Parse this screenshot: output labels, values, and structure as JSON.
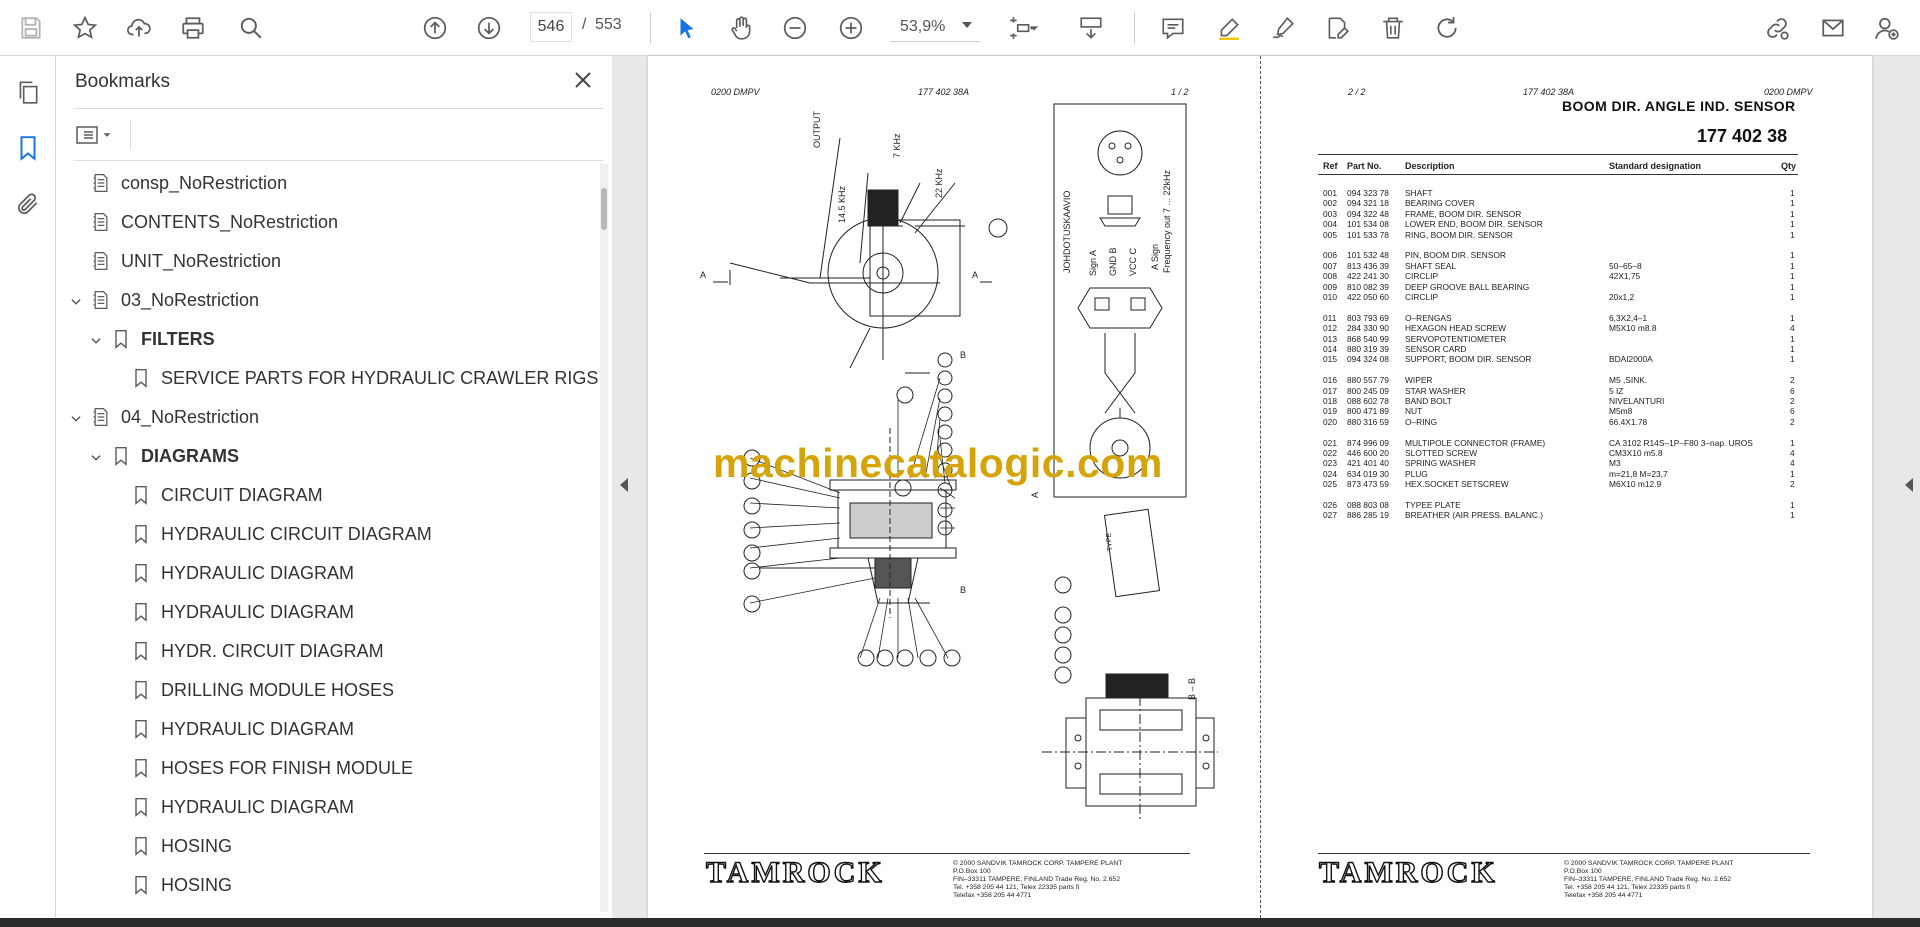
{
  "toolbar": {
    "page_current": "546",
    "page_separator": "/",
    "page_total": "553",
    "zoom_value": "53,9%"
  },
  "bookmarks_panel": {
    "title": "Bookmarks",
    "items": [
      {
        "label": "consp_NoRestriction",
        "level": 0,
        "type": "root",
        "expanded": null
      },
      {
        "label": "CONTENTS_NoRestriction",
        "level": 0,
        "type": "root",
        "expanded": null
      },
      {
        "label": "UNIT_NoRestriction",
        "level": 0,
        "type": "root",
        "expanded": null
      },
      {
        "label": "03_NoRestriction",
        "level": 0,
        "type": "root",
        "expanded": true
      },
      {
        "label": "FILTERS",
        "level": 1,
        "type": "bookmark",
        "expanded": true,
        "bold": true
      },
      {
        "label": "SERVICE PARTS FOR HYDRAULIC CRAWLER RIGS",
        "level": 2,
        "type": "bookmark",
        "expanded": null
      },
      {
        "label": "04_NoRestriction",
        "level": 0,
        "type": "root",
        "expanded": true
      },
      {
        "label": "DIAGRAMS",
        "level": 1,
        "type": "bookmark",
        "expanded": true,
        "bold": true
      },
      {
        "label": "CIRCUIT DIAGRAM",
        "level": 2,
        "type": "bookmark",
        "expanded": null
      },
      {
        "label": "HYDRAULIC CIRCUIT DIAGRAM",
        "level": 2,
        "type": "bookmark",
        "expanded": null
      },
      {
        "label": "HYDRAULIC DIAGRAM",
        "level": 2,
        "type": "bookmark",
        "expanded": null
      },
      {
        "label": "HYDRAULIC DIAGRAM",
        "level": 2,
        "type": "bookmark",
        "expanded": null
      },
      {
        "label": "HYDR. CIRCUIT DIAGRAM",
        "level": 2,
        "type": "bookmark",
        "expanded": null
      },
      {
        "label": "DRILLING MODULE HOSES",
        "level": 2,
        "type": "bookmark",
        "expanded": null
      },
      {
        "label": "HYDRAULIC DIAGRAM",
        "level": 2,
        "type": "bookmark",
        "expanded": null
      },
      {
        "label": "HOSES FOR FINISH MODULE",
        "level": 2,
        "type": "bookmark",
        "expanded": null
      },
      {
        "label": "HYDRAULIC DIAGRAM",
        "level": 2,
        "type": "bookmark",
        "expanded": null
      },
      {
        "label": "HOSING",
        "level": 2,
        "type": "bookmark",
        "expanded": null
      },
      {
        "label": "HOSING",
        "level": 2,
        "type": "bookmark",
        "expanded": null
      }
    ]
  },
  "left_page": {
    "header_code": "0200 DMPV",
    "header_part": "177 402 38A",
    "header_page": "1 /  2",
    "wiring_label": "JOHDOTUSKAAVIO",
    "sign_a": "Sign A",
    "gnd_b": "GND B",
    "vcc_c": "VCC C",
    "sign_label": "A Sign",
    "freq_label": "Frequency out 7 ... 22kHz",
    "output_label": "OUTPUT",
    "k7": "7 KHz",
    "k22": "22 KHz",
    "k145": "14.5 KHz",
    "section_a": "A",
    "section_b": "B",
    "section_bb": "B – B",
    "plate_text": "TAMROCK"
  },
  "right_page": {
    "header_page": "2 /  2",
    "header_part": "177 402 38A",
    "header_code": "0200 DMPV",
    "title": "BOOM DIR. ANGLE IND. SENSOR",
    "part_number": "177 402 38",
    "columns": {
      "ref": "Ref",
      "part_no": "Part No.",
      "description": "Description",
      "standard": "Standard designation",
      "qty": "Qty"
    },
    "rows": [
      {
        "ref": "001",
        "part": "094 323 78",
        "desc": "SHAFT",
        "std": "",
        "qty": "1"
      },
      {
        "ref": "002",
        "part": "094 321 18",
        "desc": "BEARING COVER",
        "std": "",
        "qty": "1"
      },
      {
        "ref": "003",
        "part": "094 322 48",
        "desc": "FRAME, BOOM DIR. SENSOR",
        "std": "",
        "qty": "1"
      },
      {
        "ref": "004",
        "part": "101 534 08",
        "desc": "LOWER END, BOOM DIR. SENSOR",
        "std": "",
        "qty": "1"
      },
      {
        "ref": "005",
        "part": "101 533 78",
        "desc": "RING, BOOM DIR. SENSOR",
        "std": "",
        "qty": "1"
      },
      {
        "ref": "006",
        "part": "101 532 48",
        "desc": "PIN, BOOM DIR. SENSOR",
        "std": "",
        "qty": "1"
      },
      {
        "ref": "007",
        "part": "813 436 39",
        "desc": "SHAFT SEAL",
        "std": "50–65–8",
        "qty": "1"
      },
      {
        "ref": "008",
        "part": "422 241 30",
        "desc": "CIRCLIP",
        "std": "42X1,75",
        "qty": "1"
      },
      {
        "ref": "009",
        "part": "810 082 39",
        "desc": "DEEP GROOVE BALL BEARING",
        "std": "",
        "qty": "1"
      },
      {
        "ref": "010",
        "part": "422 050 60",
        "desc": "CIRCLIP",
        "std": "20x1,2",
        "qty": "1"
      },
      {
        "ref": "011",
        "part": "803 793 69",
        "desc": "O–RENGAS",
        "std": "6,3X2,4–1",
        "qty": "1"
      },
      {
        "ref": "012",
        "part": "284 330 90",
        "desc": "HEXAGON HEAD SCREW",
        "std": "M5X10 m8.8",
        "qty": "4"
      },
      {
        "ref": "013",
        "part": "868 540 99",
        "desc": "SERVOPOTENTIOMETER",
        "std": "",
        "qty": "1"
      },
      {
        "ref": "014",
        "part": "880 319 39",
        "desc": "SENSOR CARD",
        "std": "",
        "qty": "1"
      },
      {
        "ref": "015",
        "part": "094 324 08",
        "desc": "SUPPORT, BOOM DIR. SENSOR",
        "std": "BDAI2000A",
        "qty": "1"
      },
      {
        "ref": "016",
        "part": "880 557 79",
        "desc": "WIPER",
        "std": "M5 ,SINK.",
        "qty": "2"
      },
      {
        "ref": "017",
        "part": "800 245 09",
        "desc": "STAR WASHER",
        "std": "5 IZ",
        "qty": "6"
      },
      {
        "ref": "018",
        "part": "088 602 78",
        "desc": "BAND BOLT",
        "std": "NIVELANTURI",
        "qty": "2"
      },
      {
        "ref": "019",
        "part": "800 471 89",
        "desc": "NUT",
        "std": "M5m8",
        "qty": "6"
      },
      {
        "ref": "020",
        "part": "880 316 59",
        "desc": "O–RING",
        "std": "66.4X1.78",
        "qty": "2"
      },
      {
        "ref": "021",
        "part": "874 996 09",
        "desc": "MULTIPOLE CONNECTOR (FRAME)",
        "std": "CA 3102 R14S–1P–F80 3–nap. UROS",
        "qty": "1"
      },
      {
        "ref": "022",
        "part": "446 600 20",
        "desc": "SLOTTED SCREW",
        "std": "CM3X10 m5.8",
        "qty": "4"
      },
      {
        "ref": "023",
        "part": "421 401 40",
        "desc": "SPRING WASHER",
        "std": "M3",
        "qty": "4"
      },
      {
        "ref": "024",
        "part": "634 019 30",
        "desc": "PLUG",
        "std": "m=21,8 M=23,7",
        "qty": "1"
      },
      {
        "ref": "025",
        "part": "873 473 59",
        "desc": "HEX.SOCKET SETSCREW",
        "std": "M6X10 m12.9",
        "qty": "2"
      },
      {
        "ref": "026",
        "part": "088 803 08",
        "desc": "TYPEE PLATE",
        "std": "",
        "qty": "1"
      },
      {
        "ref": "027",
        "part": "886 285 19",
        "desc": "BREATHER (AIR PRESS. BALANC.)",
        "std": "",
        "qty": "1"
      }
    ]
  },
  "footer": {
    "logo": "TAMROCK",
    "copyright_mark": "©",
    "line1": "2000  SANDVIK TAMROCK CORP. TAMPERE PLANT",
    "line2": "P.O.Box 100",
    "line3": "FIN–33311 TAMPERE, FINLAND   Trade Reg. No. 2.652",
    "line4": "Tel. +358 205 44 121, Telex 22335 parts fi",
    "line5": "Telefax +358 205 44 4771"
  },
  "watermark": "machinecatalogic.com",
  "colors": {
    "icon_gray": "#5c5c5c",
    "accent_blue": "#1473e6",
    "watermark_gold": "#d4a40a"
  }
}
